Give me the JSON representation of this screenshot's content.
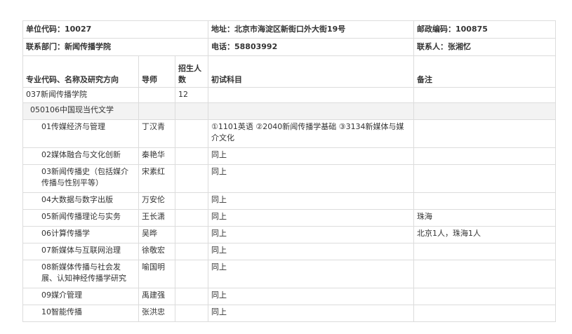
{
  "header": {
    "unit_code": "单位代码：10027",
    "address": "地址：北京市海淀区新街口外大街19号",
    "postcode": "邮政编码：100875",
    "department": "联系部门：新闻传播学院",
    "phone": "电话：58803992",
    "contact": "联系人：张湘忆"
  },
  "columns": {
    "major": "专业代码、名称及研究方向",
    "advisor": "导师",
    "quota": "招生人数",
    "exam": "初试科目",
    "note": "备注"
  },
  "school": {
    "name": "037新闻传播学院",
    "quota": "12"
  },
  "subject": {
    "name": "050106中国现当代文学"
  },
  "rows": [
    {
      "direction": "01传媒经济与管理",
      "advisor": "丁汉青",
      "exam": "①1101英语 ②2040新闻传播学基础 ③3134新媒体与媒介文化",
      "note": ""
    },
    {
      "direction": "02媒体融合与文化创新",
      "advisor": "秦艳华",
      "exam": "同上",
      "note": ""
    },
    {
      "direction": "03新闻传播史（包括媒介传播与性别平等）",
      "advisor": "宋素红",
      "exam": "同上",
      "note": ""
    },
    {
      "direction": "04大数据与数字出版",
      "advisor": "万安伦",
      "exam": "同上",
      "note": ""
    },
    {
      "direction": "05新闻传播理论与实务",
      "advisor": "王长潇",
      "exam": "同上",
      "note": "珠海"
    },
    {
      "direction": "06计算传播学",
      "advisor": "吴晔",
      "exam": "同上",
      "note": "北京1人，珠海1人"
    },
    {
      "direction": "07新媒体与互联网治理",
      "advisor": "徐敬宏",
      "exam": "同上",
      "note": ""
    },
    {
      "direction": "08新媒体传播与社会发展、认知神经传播学研究",
      "advisor": "喻国明",
      "exam": "同上",
      "note": ""
    },
    {
      "direction": "09媒介管理",
      "advisor": "禹建强",
      "exam": "同上",
      "note": ""
    },
    {
      "direction": "10智能传播",
      "advisor": "张洪忠",
      "exam": "同上",
      "note": ""
    }
  ]
}
